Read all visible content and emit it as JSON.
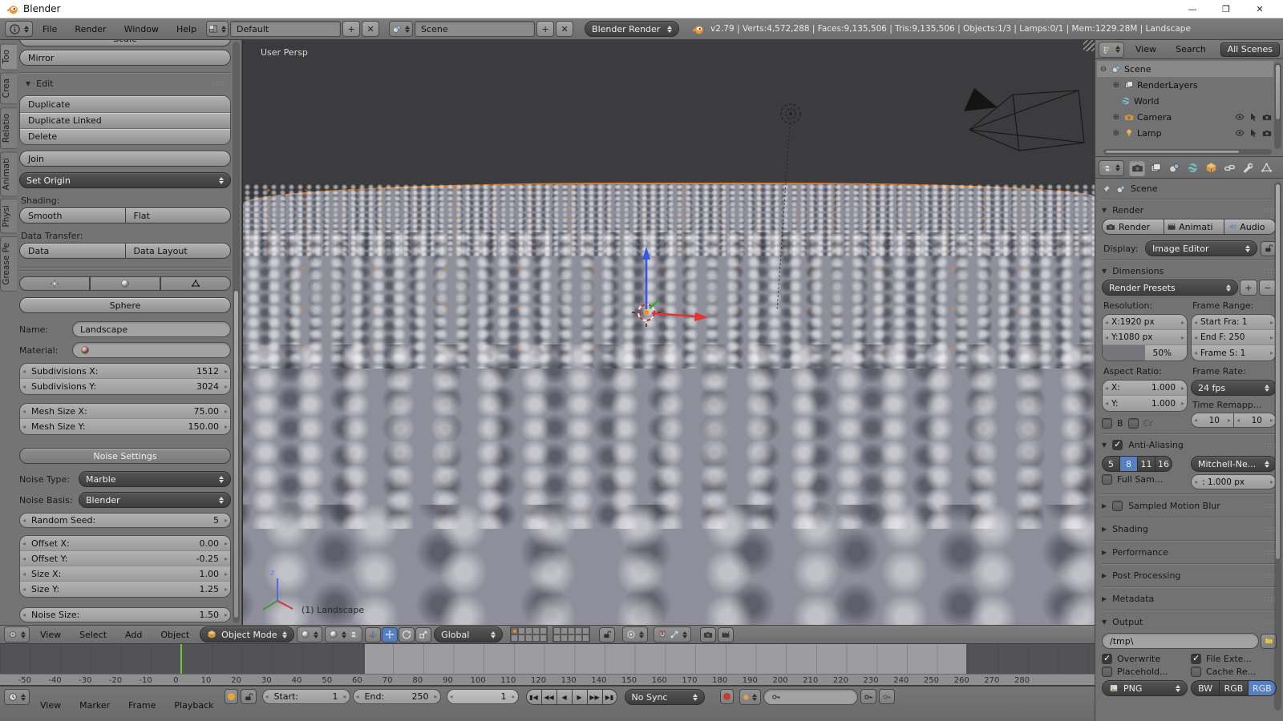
{
  "colors": {
    "accent_orange": "#e87d0d",
    "selection_blue": "#5680c2",
    "playhead_green": "#6fc93d"
  },
  "title_bar": {
    "title": "Blender",
    "minimize": "—",
    "maximize": "❐",
    "close": "✕"
  },
  "info_bar": {
    "menus": [
      "File",
      "Render",
      "Window",
      "Help"
    ],
    "layout": "Default",
    "scene": "Scene",
    "engine": "Blender Render",
    "stats": "v2.79 | Verts:4,572,288 | Faces:9,135,506 | Tris:9,135,506 | Objects:1/3 | Lamps:0/1 | Mem:1229.28M | Landscape"
  },
  "tool_shelf": {
    "tabs": [
      "Too",
      "Crea",
      "Relatio",
      "Animati",
      "Physi",
      "Grease Pe"
    ],
    "scale": "Scale",
    "mirror": "Mirror",
    "edit": {
      "title": "Edit",
      "duplicate": "Duplicate",
      "duplicate_linked": "Duplicate Linked",
      "delete": "Delete",
      "join": "Join",
      "set_origin": "Set Origin",
      "shading_label": "Shading:",
      "smooth": "Smooth",
      "flat": "Flat",
      "data_transfer_label": "Data Transfer:",
      "data": "Data",
      "data_layout": "Data Layout"
    },
    "landscape": {
      "sphere": "Sphere",
      "name_label": "Name:",
      "name": "Landscape",
      "material_label": "Material:",
      "subdivisions": [
        {
          "label": "Subdivisions X:",
          "value": "1512"
        },
        {
          "label": "Subdivisions Y:",
          "value": "3024"
        }
      ],
      "mesh_size": [
        {
          "label": "Mesh Size X:",
          "value": "75.00"
        },
        {
          "label": "Mesh Size Y:",
          "value": "150.00"
        }
      ],
      "noise_settings": "Noise Settings",
      "noise_type_label": "Noise Type:",
      "noise_type": "Marble",
      "noise_basis_label": "Noise Basis:",
      "noise_basis": "Blender",
      "random_seed": {
        "label": "Random Seed:",
        "value": "5"
      },
      "noise_params": [
        {
          "label": "Offset X:",
          "value": "0.00"
        },
        {
          "label": "Offset Y:",
          "value": "-0.25"
        },
        {
          "label": "Size X:",
          "value": "1.00"
        },
        {
          "label": "Size Y:",
          "value": "1.25"
        }
      ],
      "noise_size": {
        "label": "Noise Size:",
        "value": "1.50"
      }
    }
  },
  "viewport": {
    "view_label": "User Persp",
    "object_label": "(1) Landscape",
    "axis_z": "z",
    "header": {
      "menus": [
        "View",
        "Select",
        "Add",
        "Object"
      ],
      "mode": "Object Mode",
      "orientation": "Global"
    }
  },
  "timeline": {
    "ruler_labels": [
      "-50",
      "-40",
      "-30",
      "-20",
      "-10",
      "0",
      "10",
      "20",
      "30",
      "40",
      "50",
      "60",
      "70",
      "80",
      "90",
      "100",
      "110",
      "120",
      "130",
      "140",
      "150",
      "160",
      "170",
      "180",
      "190",
      "200",
      "210",
      "220",
      "230",
      "240",
      "250",
      "260",
      "270",
      "280"
    ],
    "footer": {
      "menus": [
        "View",
        "Marker",
        "Frame",
        "Playback"
      ],
      "start_label": "Start:",
      "start": "1",
      "end_label": "End:",
      "end": "250",
      "current": "1",
      "sync": "No Sync",
      "playback": [
        "▮◀",
        "◀◀",
        "◀",
        "▶",
        "▶▶",
        "▶▮"
      ]
    }
  },
  "outliner": {
    "menus": [
      "View",
      "Search"
    ],
    "filter": "All Scenes",
    "items": [
      {
        "label": "Scene"
      },
      {
        "label": "RenderLayers"
      },
      {
        "label": "World"
      },
      {
        "label": "Camera"
      },
      {
        "label": "Lamp"
      }
    ]
  },
  "properties": {
    "breadcrumb": "Scene",
    "render": {
      "title": "Render",
      "render_btn": "Render",
      "anim_btn": "Animati",
      "audio_btn": "Audio",
      "display_label": "Display:",
      "display": "Image Editor"
    },
    "dimensions": {
      "title": "Dimensions",
      "presets": "Render Presets",
      "plus": "+",
      "minus": "−",
      "resolution_label": "Resolution:",
      "frame_range_label": "Frame Range:",
      "res_x": "X:1920 px",
      "res_y": "Y:1080 px",
      "res_pct": "50%",
      "start": "Start Fra: 1",
      "end": "End F: 250",
      "step": "Frame S: 1",
      "aspect_label": "Aspect Ratio:",
      "frame_rate_label": "Frame Rate:",
      "aspect_x_label": "X:",
      "aspect_x": "1.000",
      "aspect_y_label": "Y:",
      "aspect_y": "1.000",
      "fps": "24 fps",
      "remap_label": "Time Remapp...",
      "remap_a": "10",
      "remap_b": "10",
      "border": "B",
      "crop": "Cr"
    },
    "anti_aliasing": {
      "title": "Anti-Aliasing",
      "samples": [
        "5",
        "8",
        "11",
        "16"
      ],
      "filter": "Mitchell-Ne...",
      "full_sample": "Full Sam...",
      "pixel_filter": ": 1.000 px"
    },
    "motion_blur": "Sampled Motion Blur",
    "collapsed": [
      "Shading",
      "Performance",
      "Post Processing",
      "Metadata"
    ],
    "output": {
      "title": "Output",
      "path": "/tmp\\",
      "overwrite": "Overwrite",
      "file_ext": "File Exte...",
      "placeholders": "Placehold...",
      "cache": "Cache Re...",
      "format": "PNG",
      "modes": [
        "BW",
        "RGB",
        "RGB"
      ]
    }
  }
}
